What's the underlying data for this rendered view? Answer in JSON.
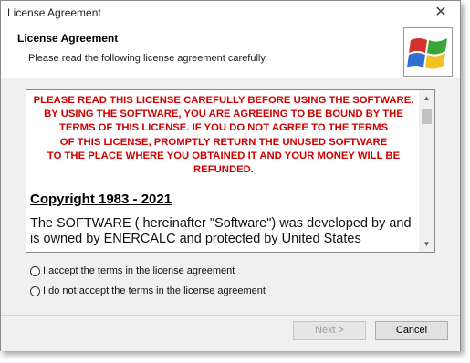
{
  "window": {
    "title": "License Agreement",
    "close_glyph": "✕"
  },
  "header": {
    "title": "License Agreement",
    "subtitle": "Please read the following license agreement carefully."
  },
  "license": {
    "warning_lines": [
      "PLEASE READ THIS LICENSE CAREFULLY BEFORE USING THE SOFTWARE.",
      "BY USING THE SOFTWARE, YOU ARE AGREEING TO BE BOUND BY THE",
      "TERMS OF THIS LICENSE. IF YOU DO NOT AGREE TO THE TERMS",
      "OF THIS LICENSE, PROMPTLY RETURN THE UNUSED SOFTWARE",
      "TO THE PLACE WHERE YOU OBTAINED IT AND YOUR MONEY WILL BE",
      "REFUNDED."
    ],
    "copyright": "Copyright  1983 - 2021",
    "body": "The SOFTWARE ( hereinafter \"Software\") was developed by and is owned by ENERCALC and protected by United States",
    "scroll_up": "▲",
    "scroll_down": "▼"
  },
  "options": {
    "accept_label": "I accept the terms in the license agreement",
    "decline_label": "I do not accept the terms in the license agreement"
  },
  "buttons": {
    "next": "Next >",
    "cancel": "Cancel"
  },
  "logo_colors": [
    "#d3322d",
    "#3aa538",
    "#2f6fd0",
    "#f2c222"
  ]
}
